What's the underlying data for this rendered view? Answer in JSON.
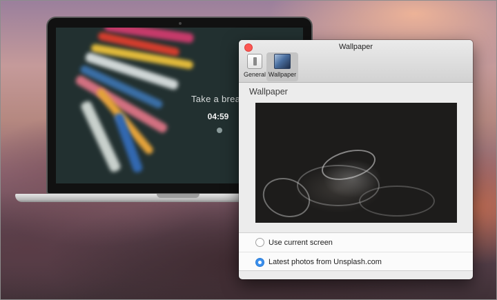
{
  "lock_screen": {
    "message": "Take a break",
    "countdown": "04:59"
  },
  "window": {
    "title": "Wallpaper",
    "toolbar": [
      {
        "label": "General",
        "icon": "general-icon",
        "selected": false
      },
      {
        "label": "Wallpaper",
        "icon": "wallpaper-icon",
        "selected": true
      }
    ],
    "section_title": "Wallpaper",
    "options": [
      {
        "label": "Use current screen",
        "checked": false
      },
      {
        "label": "Latest photos from Unsplash.com",
        "checked": true
      }
    ]
  },
  "colors": {
    "close_button": "#fc5753",
    "radio_accent": "#3b8fec"
  }
}
